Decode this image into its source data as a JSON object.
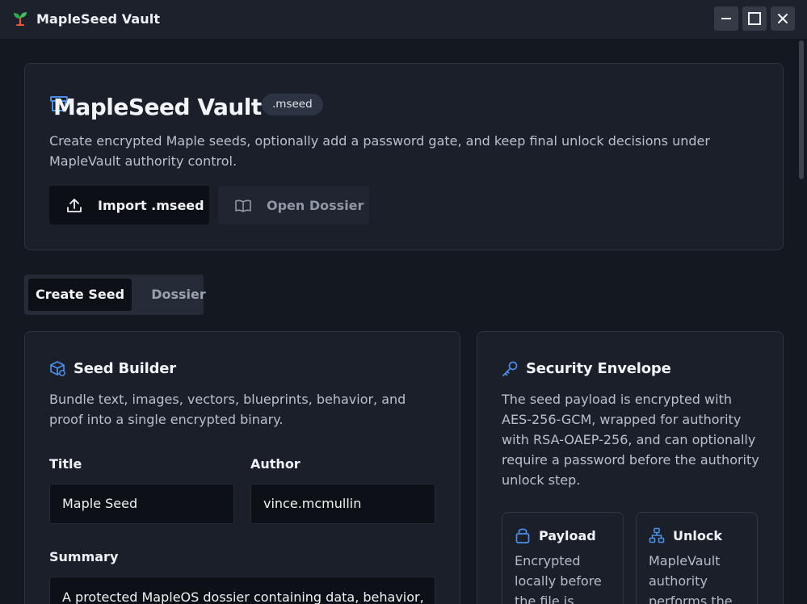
{
  "window": {
    "title": "MapleSeed Vault",
    "controls": [
      "minimize",
      "maximize",
      "close"
    ]
  },
  "hero": {
    "title": "MapleSeed Vault",
    "badge": ".mseed",
    "description": "Create encrypted Maple seeds, optionally add a password gate, and keep final unlock decisions under MapleVault authority control.",
    "import_button": "Import .mseed",
    "open_button": "Open Dossier"
  },
  "tabs": [
    {
      "label": "Create Seed",
      "active": true
    },
    {
      "label": "Dossier",
      "active": false
    }
  ],
  "builder": {
    "title": "Seed Builder",
    "description": "Bundle text, images, vectors, blueprints, behavior, and proof into a single encrypted binary.",
    "title_label": "Title",
    "title_value": "Maple Seed",
    "author_label": "Author",
    "author_value": "vince.mcmullin",
    "summary_label": "Summary",
    "summary_value": "A protected MapleOS dossier containing data, behavior,"
  },
  "security": {
    "title": "Security Envelope",
    "description": "The seed payload is encrypted with AES-256-GCM, wrapped for authority with RSA-OAEP-256, and can optionally require a password before the authority unlock step.",
    "cards": [
      {
        "title": "Payload",
        "description": "Encrypted locally before the file is",
        "icon": "lock-icon"
      },
      {
        "title": "Unlock",
        "description": "MapleVault authority performs the",
        "icon": "network-icon"
      }
    ]
  },
  "colors": {
    "background": "#141821",
    "card": "#1b1f2a",
    "accent": "#4b8fe8"
  }
}
